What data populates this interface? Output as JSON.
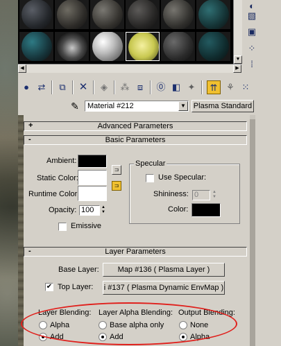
{
  "material": {
    "name": "Material #212",
    "type_button": "Plasma Standard"
  },
  "rollouts": {
    "advanced": {
      "sign": "+",
      "title": "Advanced Parameters"
    },
    "basic": {
      "sign": "-",
      "title": "Basic Parameters"
    },
    "layer": {
      "sign": "-",
      "title": "Layer Parameters"
    }
  },
  "basic_params": {
    "ambient_label": "Ambient:",
    "static_color_label": "Static Color:",
    "runtime_color_label": "Runtime Color:",
    "opacity_label": "Opacity:",
    "opacity_value": "100",
    "emissive_label": "Emissive",
    "colors": {
      "ambient": "#000000",
      "static": "#ffffff",
      "runtime": "#ffffff",
      "specular": "#000000"
    }
  },
  "specular": {
    "group_title": "Specular",
    "use_specular_label": "Use Specular:",
    "shininess_label": "Shininess:",
    "shininess_value": "0",
    "color_label": "Color:"
  },
  "layer_params": {
    "base_layer_label": "Base Layer:",
    "base_layer_value": "Map #136  ( Plasma Layer )",
    "top_layer_label": "Top Layer:",
    "top_layer_value": "i #137  ( Plasma Dynamic EnvMap )",
    "top_layer_checked": true,
    "layer_blending": {
      "label": "Layer Blending:",
      "options": [
        "Alpha",
        "Add"
      ],
      "selected": "Add"
    },
    "alpha_blending": {
      "label": "Layer Alpha Blending:",
      "options": [
        "Base alpha only",
        "Add"
      ],
      "selected": "Add"
    },
    "output_blending": {
      "label": "Output Blending:",
      "options": [
        "None",
        "Alpha"
      ],
      "selected": "Alpha"
    }
  },
  "icons": {
    "right_toolbar": [
      "sample-type-icon",
      "backlight-icon",
      "background-icon",
      "uv-tiling-icon",
      "video-check-icon",
      "make-preview-icon",
      "options-icon",
      "select-by-material-icon"
    ],
    "top_toolbar": [
      "get-material-icon",
      "put-to-scene-icon",
      "assign-to-selection-icon",
      "reset-map-icon",
      "make-copy-icon",
      "make-unique-icon",
      "put-to-library-icon",
      "material-id-icon",
      "show-map-icon",
      "show-end-result-icon",
      "go-to-parent-icon",
      "go-forward-icon"
    ]
  },
  "colors": {
    "annotation": "#e0201c",
    "active_tool": "#f0c030"
  }
}
